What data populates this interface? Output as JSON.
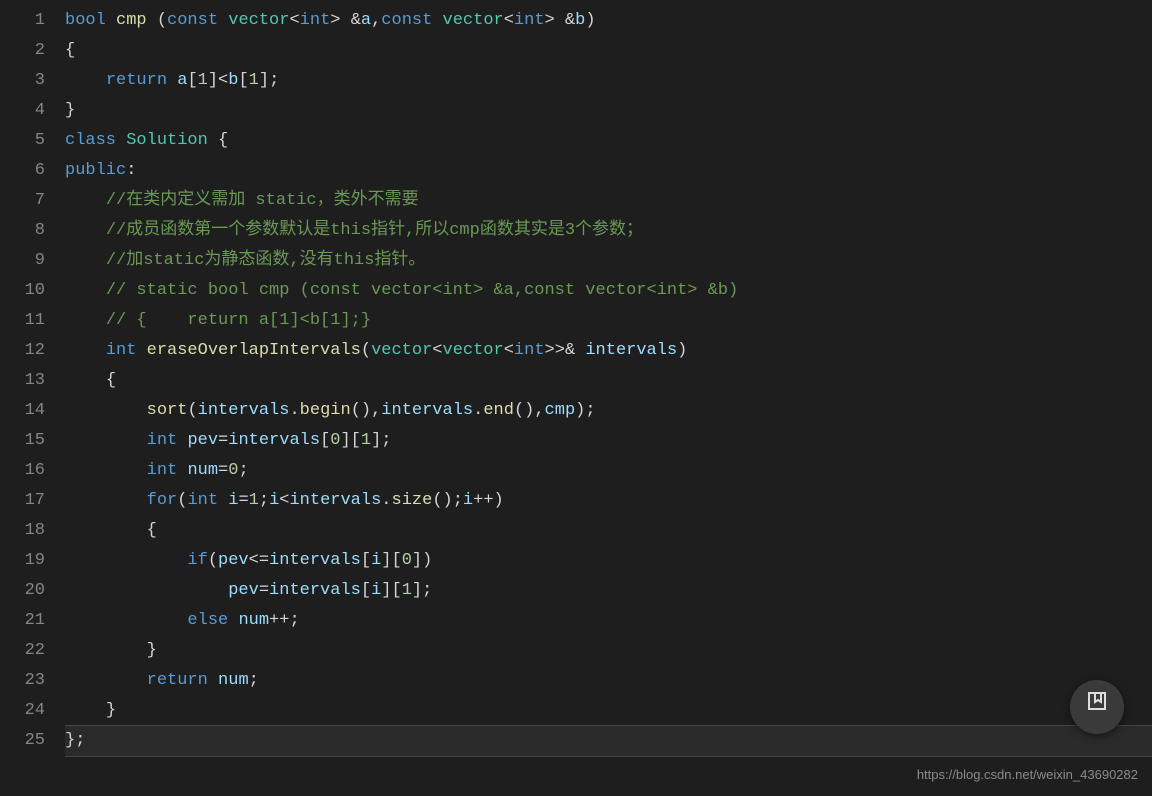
{
  "lines": [
    "1",
    "2",
    "3",
    "4",
    "5",
    "6",
    "7",
    "8",
    "9",
    "10",
    "11",
    "12",
    "13",
    "14",
    "15",
    "16",
    "17",
    "18",
    "19",
    "20",
    "21",
    "22",
    "23",
    "24",
    "25"
  ],
  "code": {
    "l1": {
      "bool": "bool",
      "cmp": "cmp",
      "const1": "const",
      "vec1": "vector",
      "int1": "int",
      "a": "a",
      "const2": "const",
      "vec2": "vector",
      "int2": "int",
      "b": "b"
    },
    "l2": "{",
    "l3": {
      "ret": "return",
      "a": "a",
      "one1": "1",
      "b": "b",
      "one2": "1"
    },
    "l4": "}",
    "l5": {
      "class": "class",
      "sol": "Solution"
    },
    "l6": {
      "pub": "public",
      "colon": ":"
    },
    "l7": "//在类内定义需加 static，类外不需要",
    "l8": "//成员函数第一个参数默认是this指针,所以cmp函数其实是3个参数；",
    "l9": "//加static为静态函数,没有this指针。",
    "l10": "// static bool cmp (const vector<int> &a,const vector<int> &b)",
    "l11": "// {    return a[1]<b[1];}",
    "l12": {
      "int": "int",
      "fn": "eraseOverlapIntervals",
      "vec1": "vector",
      "vec2": "vector",
      "int2": "int",
      "intervals": "intervals"
    },
    "l13": "{",
    "l14": {
      "sort": "sort",
      "intervals1": "intervals",
      "begin": "begin",
      "intervals2": "intervals",
      "end": "end",
      "cmp": "cmp"
    },
    "l15": {
      "int": "int",
      "pev": "pev",
      "intervals": "intervals",
      "z": "0",
      "o": "1"
    },
    "l16": {
      "int": "int",
      "num": "num",
      "z": "0"
    },
    "l17": {
      "for": "for",
      "int": "int",
      "i": "i",
      "one": "1",
      "i2": "i",
      "intervals": "intervals",
      "size": "size",
      "i3": "i"
    },
    "l18": "{",
    "l19": {
      "if": "if",
      "pev": "pev",
      "intervals": "intervals",
      "i": "i",
      "z": "0"
    },
    "l20": {
      "pev": "pev",
      "intervals": "intervals",
      "i": "i",
      "o": "1"
    },
    "l21": {
      "else": "else",
      "num": "num"
    },
    "l22": "}",
    "l23": {
      "ret": "return",
      "num": "num"
    },
    "l24": "}",
    "l25": "};"
  },
  "watermark": "https://blog.csdn.net/weixin_43690282"
}
